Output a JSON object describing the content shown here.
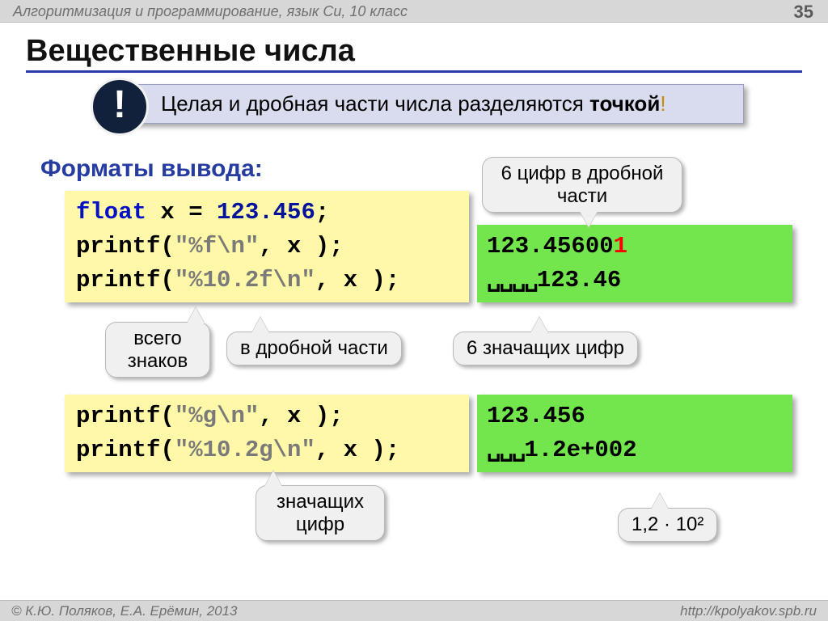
{
  "header": "Алгоритмизация и программирование, язык Си, 10 класс",
  "page_number": "35",
  "title": "Вещественные числа",
  "badge": "!",
  "callout_text": "Целая и дробная части числа разделяются ",
  "callout_bold": "точкой",
  "callout_bang": "!",
  "subhead": "Форматы вывода:",
  "code1": {
    "kw1": "float",
    "var1": " x = ",
    "num": "123.456",
    "semi": ";",
    "l2a": "printf(",
    "l2b": "\"%f\\n\"",
    "l2c": ", x );",
    "l3a": "printf(",
    "l3b": "\"%10.2f\\n\"",
    "l3c": ", x );"
  },
  "out1": {
    "l1a": "123.45600",
    "l1b": "1",
    "l2a": "␣␣␣␣",
    "l2b": "123.46"
  },
  "code2": {
    "l1a": "printf(",
    "l1b": "\"%g\\n\"",
    "l1c": ", x );",
    "l2a": "printf(",
    "l2b": "\"%10.2g\\n\"",
    "l2c": ", x );"
  },
  "out2": {
    "l1": "123.456",
    "l2a": "␣␣␣",
    "l2b": "1.2e+002"
  },
  "bubbles": {
    "b1": "6 цифр в дробной\nчасти",
    "b2": "всего\nзнаков",
    "b3": "в дробной части",
    "b4": "6 значащих цифр",
    "b5": "значащих\nцифр",
    "b6": "1,2 · 10²"
  },
  "footer_left": "© К.Ю. Поляков, Е.А. Ерёмин, 2013",
  "footer_right": "http://kpolyakov.spb.ru"
}
